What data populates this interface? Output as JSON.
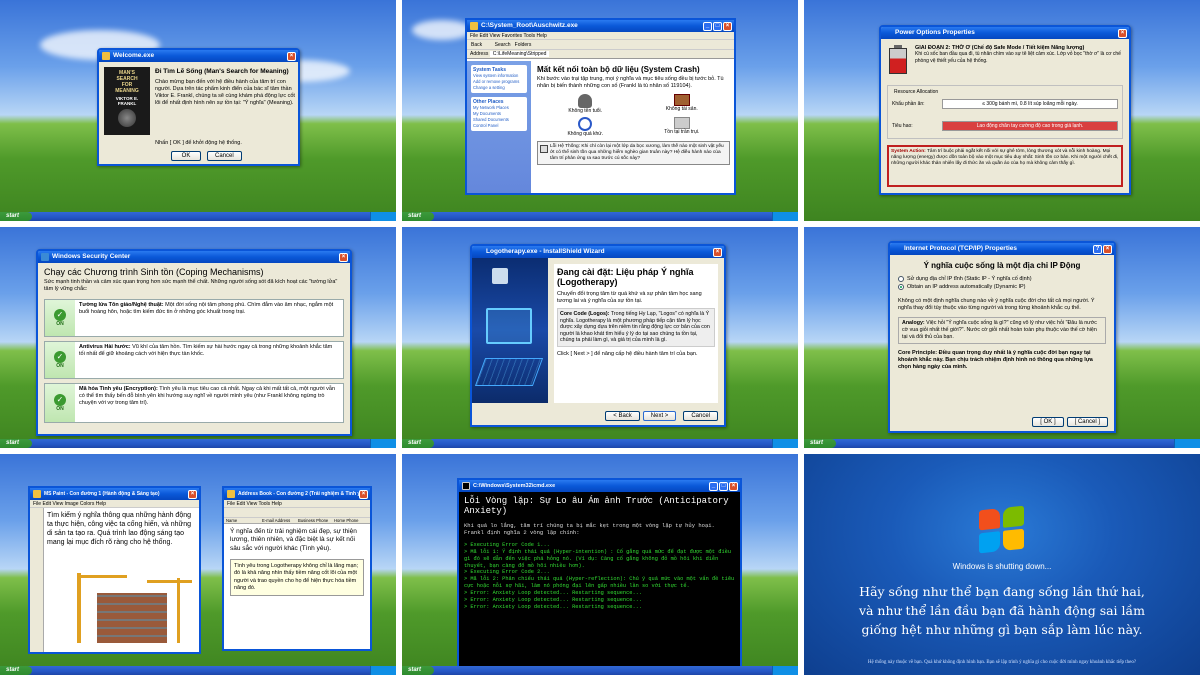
{
  "p1": {
    "title": "Welcome.exe",
    "heading": "Đi Tìm Lẽ Sống (Man's Search for Meaning)",
    "body": "Chào mừng bạn đến với hệ điều hành của tâm trí con người. Dựa trên tác phẩm kinh điển của bác sĩ tâm thần Viktor E. Frankl, chúng ta sẽ cùng khám phá động lực cốt lõi để nhất định hình nên sự tồn tại: \"Ý nghĩa\" (Meaning).",
    "prompt": "Nhấn [ OK ] để khởi động hệ thống.",
    "ok": "OK",
    "cancel": "Cancel",
    "book": [
      "MAN'S",
      "SEARCH",
      "FOR",
      "MEANING",
      "VIKTOR E.",
      "FRANKL"
    ],
    "start": "start"
  },
  "p2": {
    "title": "C:\\System_Root\\Auschwitz.exe",
    "menu": "File  Edit  View  Favorites  Tools  Help",
    "back": "Back",
    "search": "Search",
    "folders": "Folders",
    "address": "C:\\LifeMeaning\\Stripped",
    "tasks_title": "System Tasks",
    "tasks": [
      "View system information",
      "Add or remove programs",
      "Change a setting"
    ],
    "other_title": "Other Places",
    "other": [
      "My Network Places",
      "My Documents",
      "Shared Documents",
      "Control Panel"
    ],
    "heading": "Mất kết nối toàn bộ dữ liệu (System Crash)",
    "body": "Khi bước vào trại tập trung, mọi ý nghĩa và mục tiêu sống đều bị tước bỏ. Tù nhân bị biến thành những con số (Frankl là tù nhân số 119104).",
    "items": [
      "Không tên tuổi.",
      "Không tài sản.",
      "Không quá khứ.",
      "Tồn tại trần trụi."
    ],
    "warning": "Lỗi Hệ Thống: Khi chỉ còn lại một lớp da bọc xương, làm thế nào một sinh vật yếu ớt có thể sinh tồn qua những hiểm nghèo gian truân này? Hệ điều hành nào của tâm trí phản ứng ra sao trước cú sốc này?",
    "start": "start"
  },
  "p3": {
    "title": "Power Options Properties",
    "heading": "GIAI ĐOẠN 2: THỜ Ơ (Chế độ Safe Mode / Tiết kiệm Năng lượng)",
    "body": "Khi cú sốc ban đầu qua đi, tù nhân chìm vào sự tê liệt cảm xúc. Lớp vỏ bọc \"thờ ơ\" là cơ chế phòng vệ thiết yếu của hệ thống.",
    "group": "Resource Allocation",
    "row1_label": "Khẩu phần ăn:",
    "row1_value": "≤ 300g bánh mì, 0.8 lít súp loãng mỗi ngày.",
    "row2_label": "Tiêu hao:",
    "row2_value": "Lao động chân tay cường độ cao trong giá lạnh.",
    "action_label": "System Action:",
    "action": "Tâm trí buộc phải ngắt kết nối với sự ghê tởm, lòng thương xót và nỗi kinh hoàng. Mọi năng lượng (energy) được dồn toàn bộ vào một mục tiêu duy nhất: Sinh tồn cơ bản. Khi một người chết đi, những người khác thản nhiên lấy đi thức ăn và quần áo của họ mà không cảm thấy gì.",
    "start": "start"
  },
  "p4": {
    "title": "Windows Security Center",
    "heading": "Chạy các Chương trình Sinh tồn (Coping Mechanisms)",
    "body": "Sức mạnh tinh thần và cảm xúc quan trọng hơn sức mạnh thể chất. Những người sống sót đã kích hoạt các \"tường lửa\" tâm lý vững chắc:",
    "items": [
      {
        "title": "Tường lửa Tôn giáo/Nghệ thuật:",
        "text": "Một đời sống nội tâm phong phú. Chìm đắm vào âm nhạc, ngắm một buổi hoàng hôn, hoặc tìm kiếm đức tin ở những góc khuất trong trại.",
        "badge": "ON"
      },
      {
        "title": "Antivirus Hài hước:",
        "text": "Vũ khí của tâm hồn. Tìm kiếm sự hài hước ngay cả trong những khoảnh khắc tăm tối nhất để giữ khoảng cách với hiện thực tàn khốc.",
        "badge": "ON"
      },
      {
        "title": "Mã hóa Tình yêu (Encryption):",
        "text": "Tình yêu là mục tiêu cao cả nhất. Ngay cả khi mất tất cả, một người vẫn có thể tìm thấy bến đỗ bình yên khi hướng suy nghĩ về người mình yêu (như Frankl không ngừng trò chuyện với vợ trong tâm trí).",
        "badge": "ON"
      }
    ],
    "start": "start"
  },
  "p5": {
    "title": "Logotherapy.exe - InstallShield Wizard",
    "heading": "Đang cài đặt: Liệu pháp Ý nghĩa (Logotherapy)",
    "body": "Chuyển đổi trọng tâm từ quá khứ và sự phân tâm học sang tương lai và ý nghĩa của sự tồn tại.",
    "core_label": "Core Code (Logos):",
    "core": "Trong tiếng Hy Lạp, \"Logos\" có nghĩa là Ý nghĩa. Logotherapy là một phương pháp tiếp cận tâm lý học được xây dựng dựa trên niềm tin rằng động lực cơ bản của con người là khao khát tìm hiểu ý lý do tại sao chúng ta tồn tại, chúng ta phải làm gì, và giá trị của mình là gì.",
    "prompt": "Click [ Next > ] để nâng cấp hệ điều hành tâm trí của bạn.",
    "back": "< Back",
    "next": "Next >",
    "cancel": "Cancel",
    "start": "start"
  },
  "p6": {
    "title": "Internet Protocol (TCP/IP) Properties",
    "heading": "Ý nghĩa cuộc sống là một địa chỉ IP Động",
    "opt1": "Sử dụng địa chỉ IP tĩnh (Static IP - Ý nghĩa cố định)",
    "opt2": "Obtain an IP address automatically (Dynamic IP)",
    "body": "Không có một định nghĩa chung nào về ý nghĩa cuộc đời cho tất cả mọi người. Ý nghĩa thay đổi tùy thuộc vào từng người và trong từng khoảnh khắc cụ thể.",
    "analogy_label": "Analogy:",
    "analogy": "Việc hỏi \"Ý nghĩa cuộc sống là gì?\" cũng vô lý như việc hỏi \"Đâu là nước cờ vua giỏi nhất thế giới?\". Nước cờ giỏi nhất hoàn toàn phụ thuộc vào thế cờ hiện tại và đối thủ của bạn.",
    "core_label": "Core Principle:",
    "core": "Điều quan trọng duy nhất là ý nghĩa cuộc đời bạn ngay tại khoảnh khắc này. Bạn chịu trách nhiệm định hình nó thông qua những lựa chọn hàng ngày của mình.",
    "ok": "[ OK ]",
    "cancel": "[ Cancel ]",
    "start": "start"
  },
  "p7": {
    "paint_title": "MS Paint - Con đường 1 (Hành động & Sáng tạo)",
    "paint_text": "Tìm kiếm ý nghĩa thông qua những hành động ta thực hiện, công việc ta cống hiến, và những di sản ta tạo ra. Quá trình lao động sáng tạo mang lại mục đích rõ ràng cho hệ thống.",
    "ab_title": "Address Book - Con đường 2 (Trải nghiệm & Tình yêu)",
    "ab_cols": [
      "Name",
      "E-mail Address",
      "Business Phone",
      "Home Phone"
    ],
    "ab_text": "Ý nghĩa đến từ trải nghiệm cái đẹp, sự thiện lương, thiên nhiên, và đặc biệt là sự kết nối sâu sắc với người khác (Tình yêu).",
    "ab_note": "Tình yêu trong Logotherapy không chỉ là lãng mạn; đó là khả năng nhìn thấy tiềm năng cốt lõi của một người và trao quyền cho họ để hiện thực hóa tiềm năng đó.",
    "start": "start"
  },
  "p8": {
    "title": "C:\\Windows\\System32\\cmd.exe",
    "heading": "Lỗi Vòng lặp: Sự Lo âu Ám ảnh Trước (Anticipatory Anxiety)",
    "body": "Khi quá lo lắng, tâm trí chúng ta bị mắc kẹt trong một vòng lặp tự hủy hoại. Frankl định nghĩa 2 vòng lặp chính:",
    "lines": [
      "> Executing Error Code 1...",
      "> Mã lỗi 1: Ý định thái quá (Hyper-intention) : Cố gắng quá mức để đạt được một điều gì đó sẽ dẫn đến việc phá hỏng nó. (Ví dụ: Càng cố gắng không đỏ mồ hôi khi diễn thuyết, bạn càng đổ mồ hôi nhiều hơn).",
      "> Executing Error Code 2...",
      "> Mã lỗi 2: Phản chiếu thái quá (Hyper-reflection): Chú ý quá mức vào một vấn đề tiêu cực hoặc nỗi sợ hãi, làm nó phóng đại lên gấp nhiều lần so với thực tế.",
      "> Error: Anxiety Loop detected... Restarting sequence...",
      "> Error: Anxiety Loop detected... Restarting sequence...",
      "> Error: Anxiety Loop detected... Restarting sequence..."
    ],
    "start": "start"
  },
  "p9": {
    "status": "Windows is shutting down...",
    "quote": [
      "Hãy sống như thể bạn đang sống lần thứ hai,",
      "và như thể lần đầu bạn đã hành động sai lầm",
      "giống hệt như những gì bạn sắp làm lúc này."
    ],
    "footer": "Hệ thống này thuộc về bạn. Quá khứ không định hình bạn. Bạn sẽ lập trình ý nghĩa gì cho cuộc đời mình ngay khoảnh khắc tiếp theo?"
  }
}
